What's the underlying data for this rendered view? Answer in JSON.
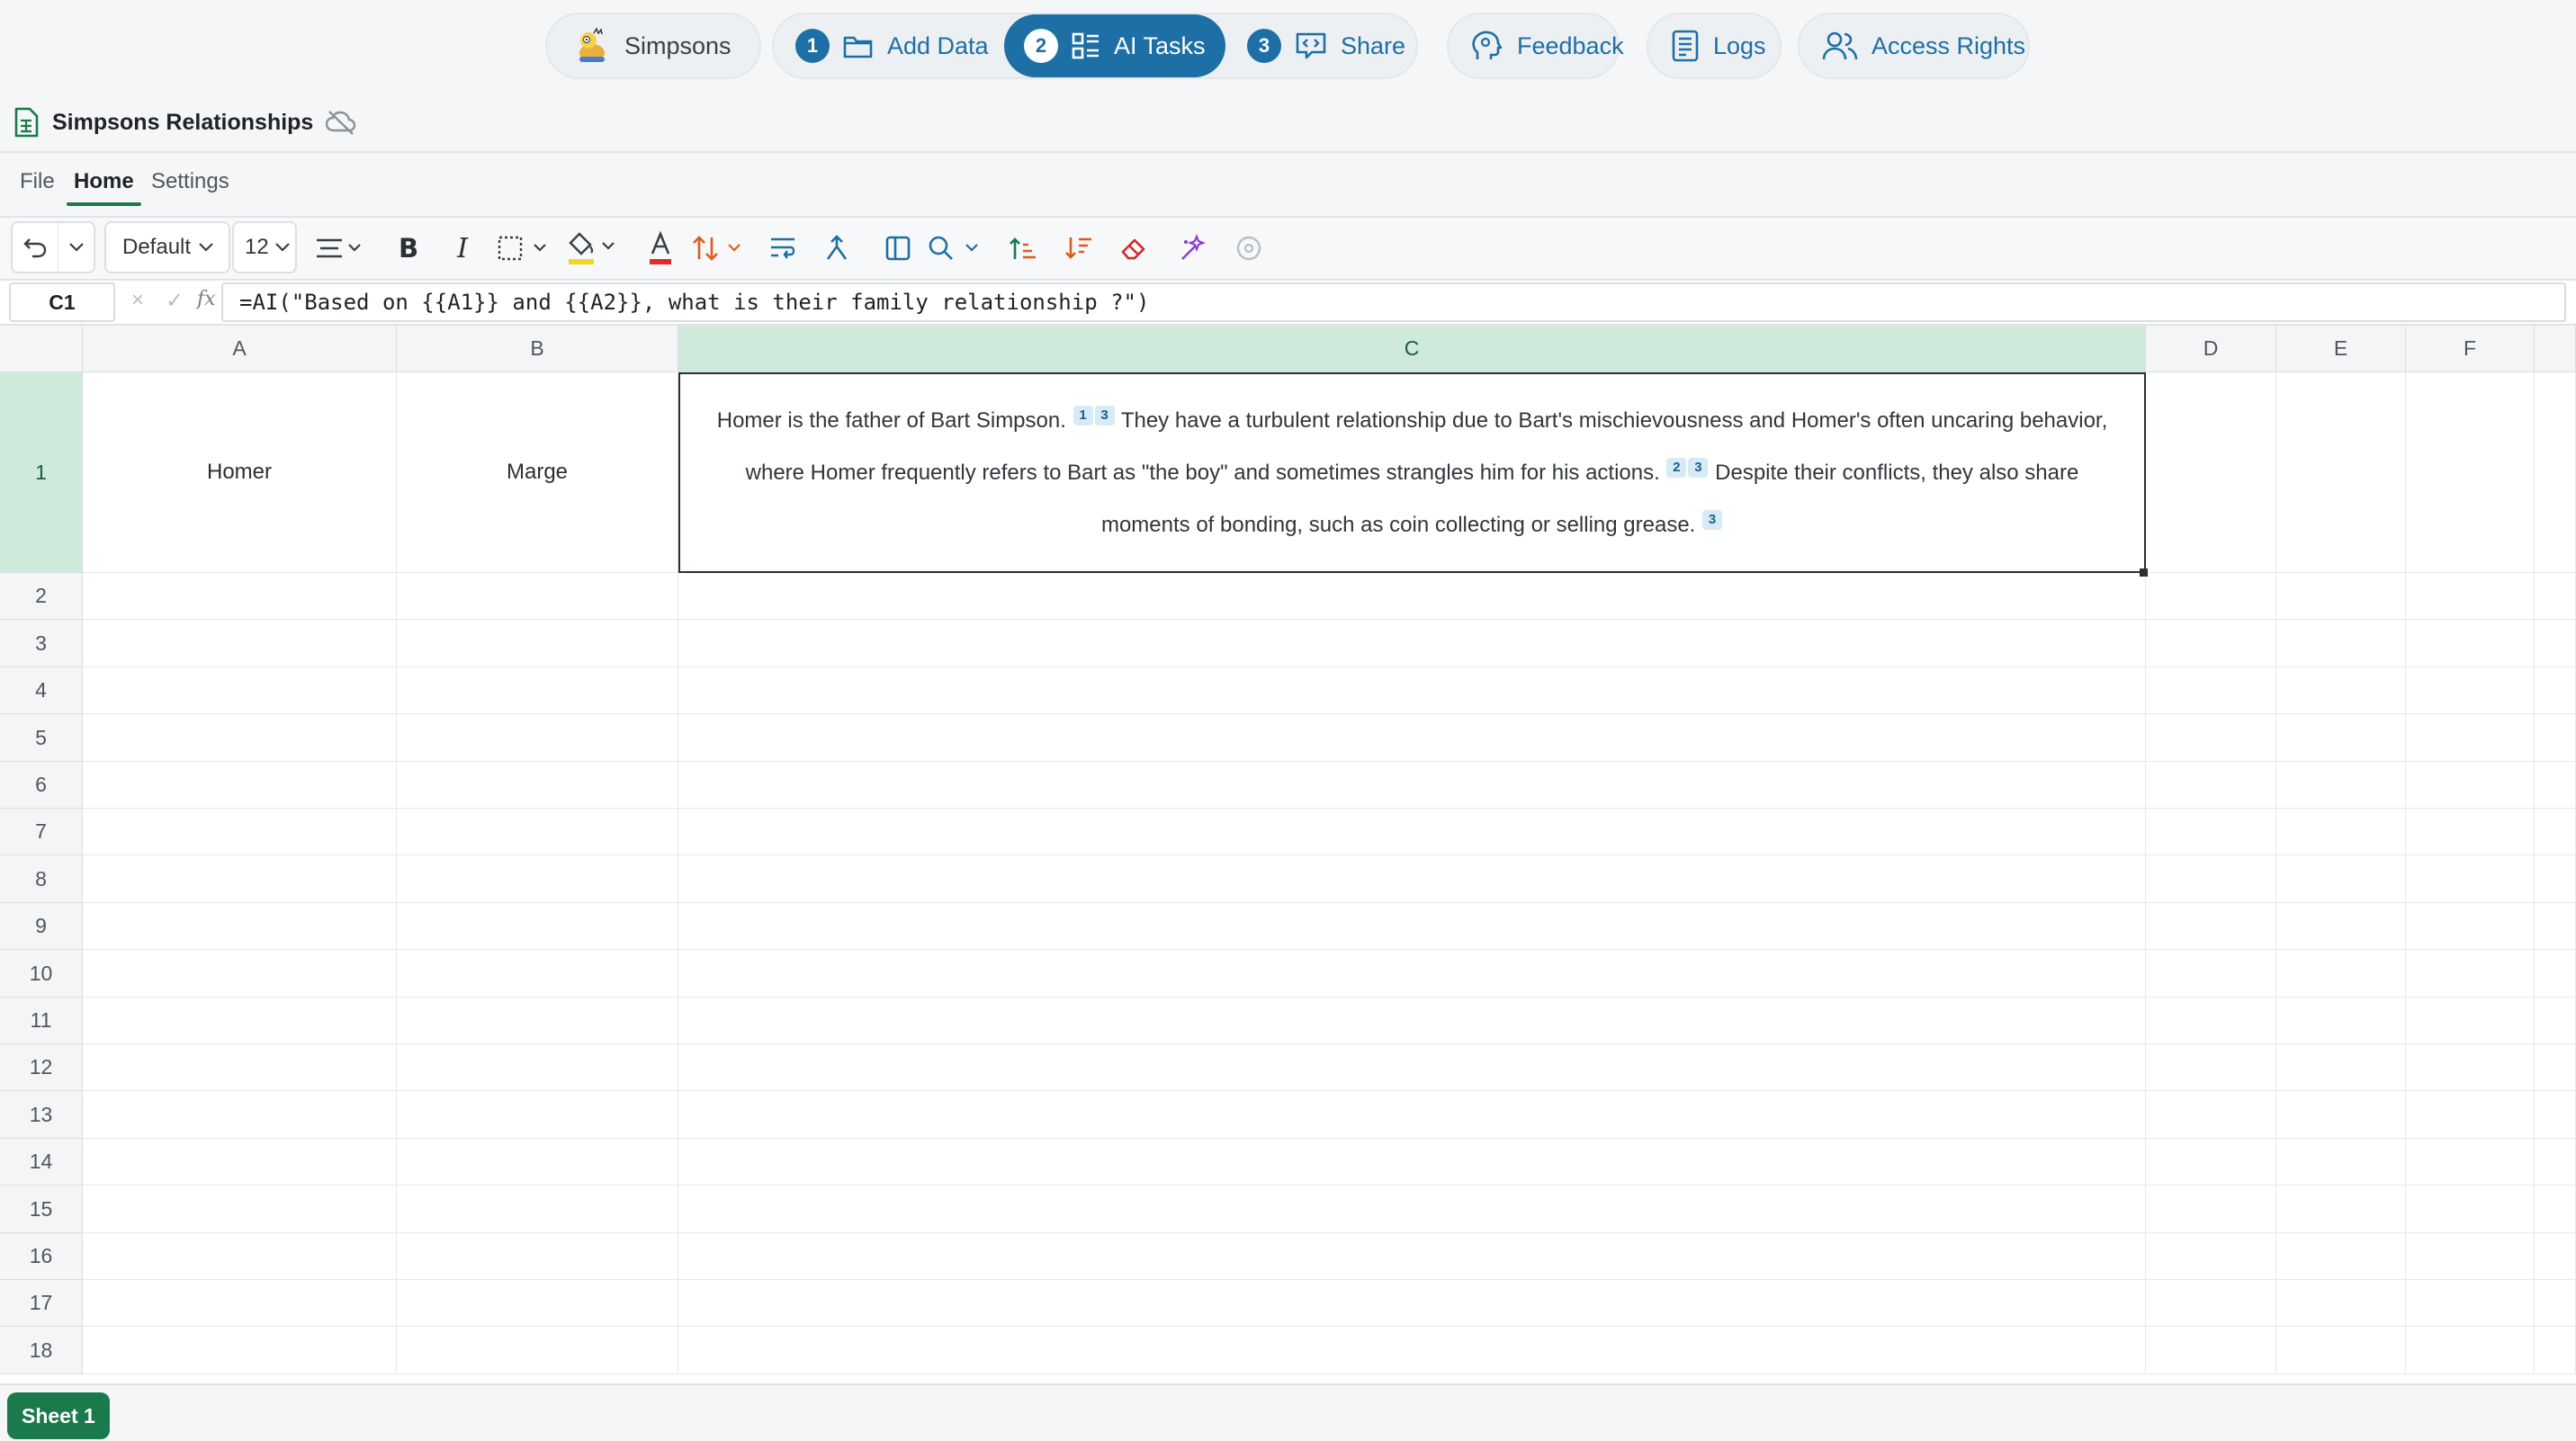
{
  "nav": {
    "brand_label": "Simpsons",
    "steps": [
      {
        "num": "1",
        "label": "Add Data"
      },
      {
        "num": "2",
        "label": "AI Tasks"
      },
      {
        "num": "3",
        "label": "Share"
      }
    ],
    "feedback_label": "Feedback",
    "logs_label": "Logs",
    "access_label": "Access Rights",
    "accent_color": "#1d6fa5"
  },
  "document": {
    "title": "Simpsons Relationships"
  },
  "menu": {
    "file": "File",
    "home": "Home",
    "settings": "Settings",
    "active": "Home"
  },
  "toolbar": {
    "font_name": "Default",
    "font_size": "12"
  },
  "formula_bar": {
    "cell_ref": "C1",
    "cancel_symbol": "×",
    "confirm_symbol": "✓",
    "fx_label": "fx",
    "formula": "=AI(\"Based on {{A1}} and {{A2}}, what is their family relationship ?\")"
  },
  "grid": {
    "columns": [
      "A",
      "B",
      "C",
      "D",
      "E",
      "F"
    ],
    "rows": [
      "1",
      "2",
      "3",
      "4",
      "5",
      "6",
      "7",
      "8",
      "9",
      "10",
      "11",
      "12",
      "13",
      "14",
      "15",
      "16",
      "17",
      "18"
    ],
    "selected_column": "C",
    "selected_row": "1",
    "cells": {
      "A1": "Homer",
      "B1": "Marge",
      "C1": {
        "part1": "Homer is the father of Bart Simpson.",
        "cite1a": "1",
        "cite1b": "3",
        "part2": "They have a turbulent relationship due to Bart's mischievousness and Homer's often uncaring behavior, where Homer frequently refers to Bart as \"the boy\" and sometimes strangles him for his actions.",
        "cite2a": "2",
        "cite2b": "3",
        "part3": "Despite their conflicts, they also share moments of bonding, such as coin collecting or selling grease.",
        "cite3": "3"
      }
    }
  },
  "sheets": [
    {
      "name": "Sheet 1",
      "active": true
    }
  ],
  "colors": {
    "sheet_green": "#1b7a4c",
    "selected_header": "#cfeadb"
  }
}
